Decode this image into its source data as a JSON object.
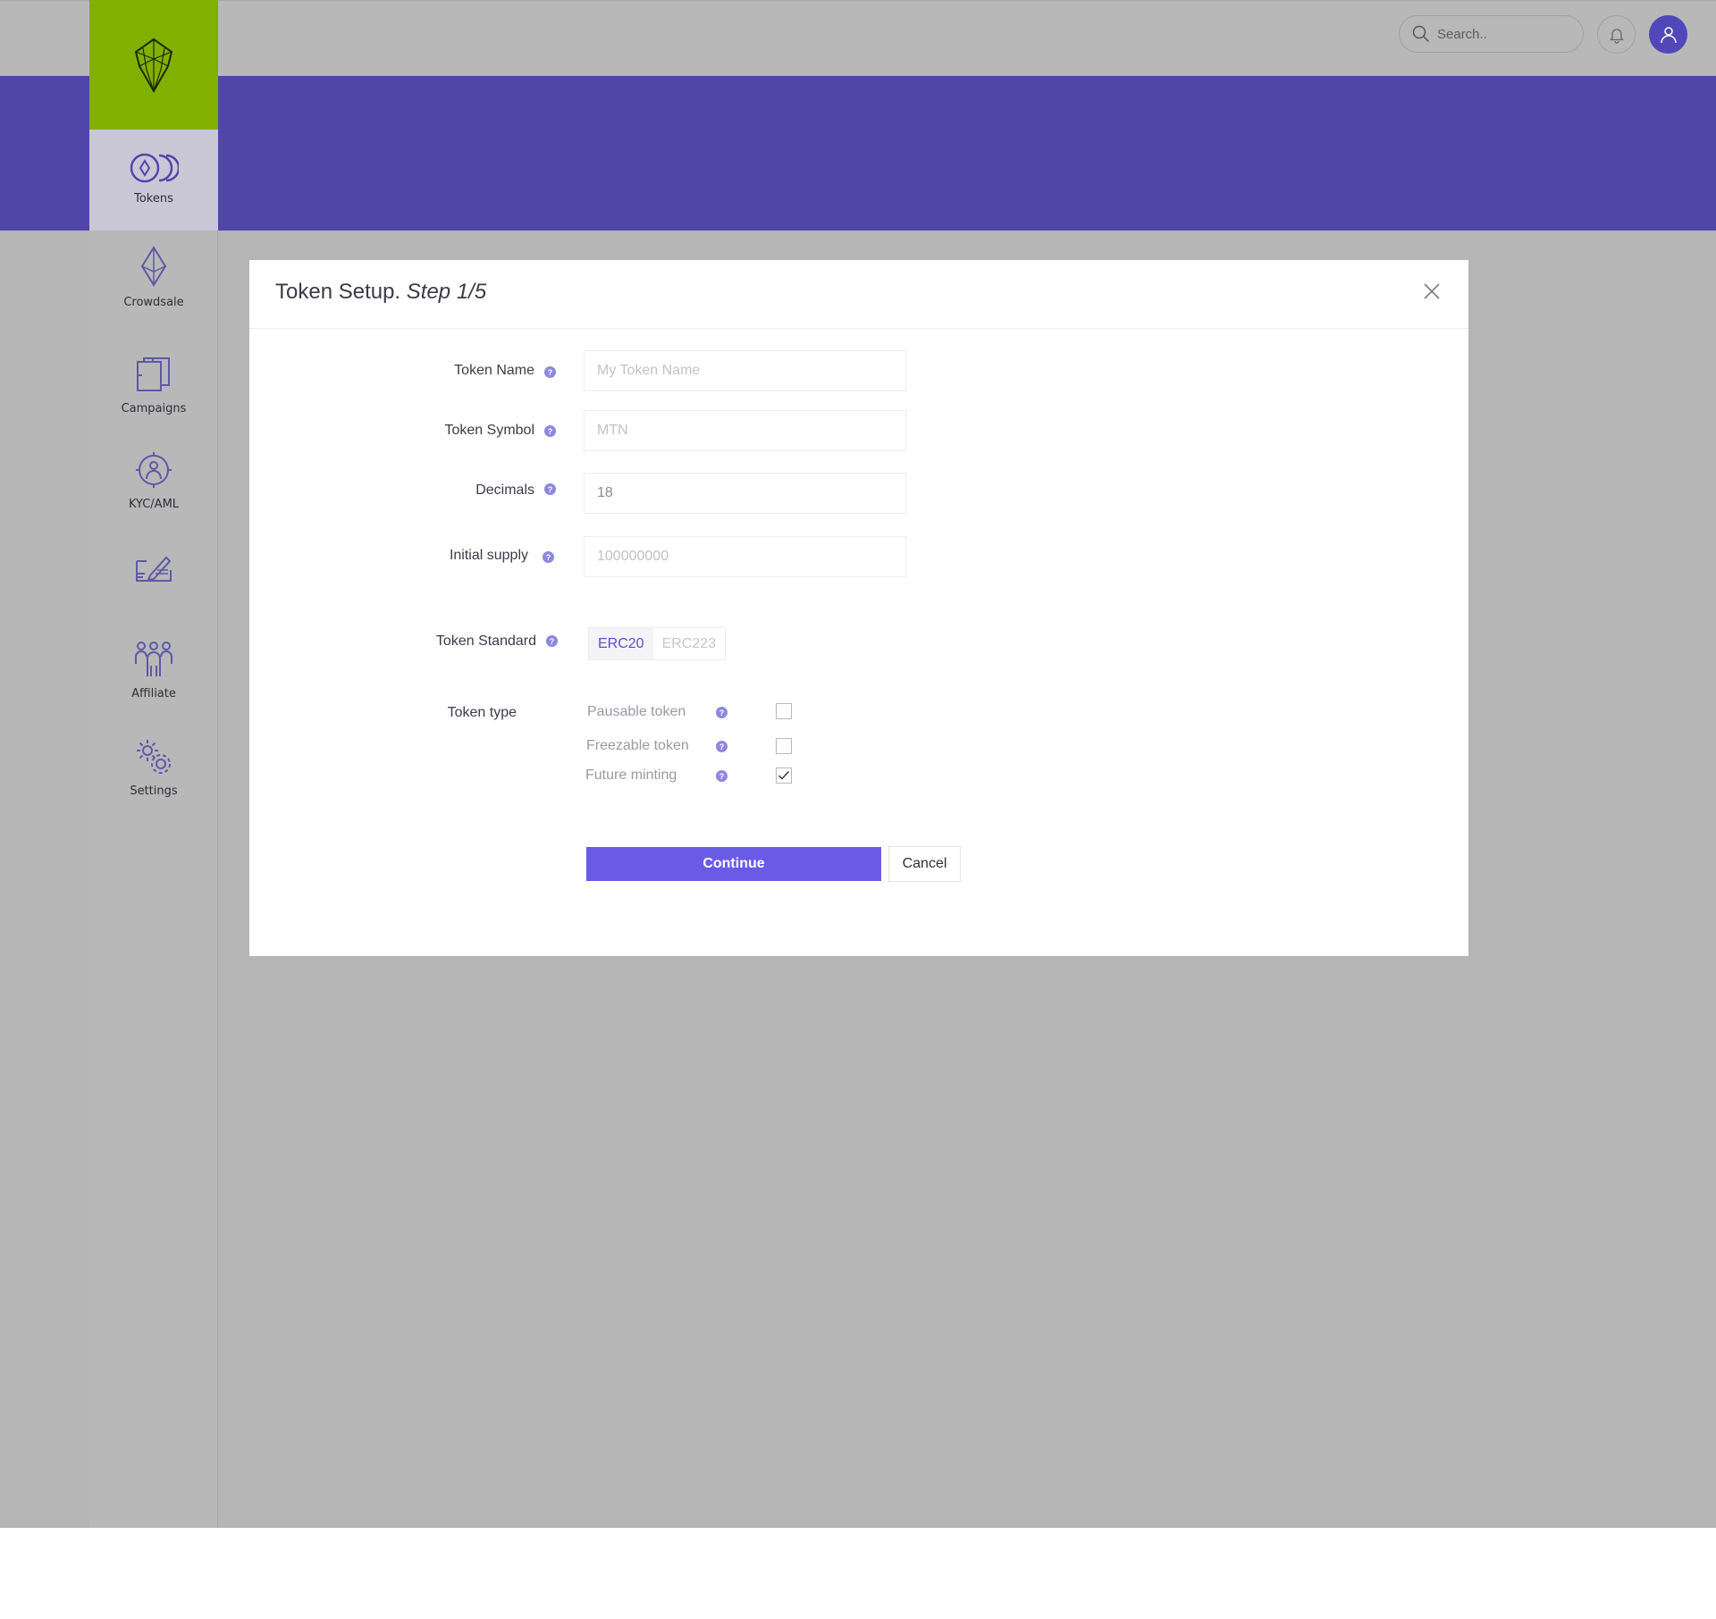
{
  "header": {
    "search_placeholder": "Search.."
  },
  "sidebar": {
    "items": [
      {
        "label": "Tokens",
        "icon": "tokens-icon",
        "active": true
      },
      {
        "label": "Crowdsale",
        "icon": "ethereum-icon"
      },
      {
        "label": "Campaigns",
        "icon": "campaigns-icon"
      },
      {
        "label": "KYC/AML",
        "icon": "kyc-target-icon"
      },
      {
        "label": "",
        "icon": "signature-icon"
      },
      {
        "label": "Affiliate",
        "icon": "affiliate-group-icon"
      },
      {
        "label": "Settings",
        "icon": "settings-gears-icon"
      }
    ]
  },
  "modal": {
    "title": "Token Setup.",
    "step": "Step 1/5",
    "fields": {
      "token_name": {
        "label": "Token Name",
        "placeholder": "My Token Name"
      },
      "token_symbol": {
        "label": "Token Symbol",
        "placeholder": "MTN"
      },
      "decimals": {
        "label": "Decimals",
        "value": "18"
      },
      "initial_supply": {
        "label": "Initial supply",
        "placeholder": "100000000"
      }
    },
    "token_standard": {
      "label": "Token Standard",
      "options": [
        "ERC20",
        "ERC223"
      ],
      "selected": "ERC20"
    },
    "token_type": {
      "label": "Token type",
      "options": [
        {
          "label": "Pausable token",
          "checked": false
        },
        {
          "label": "Freezable token",
          "checked": false
        },
        {
          "label": "Future minting",
          "checked": true
        }
      ]
    },
    "help_glyph": "?",
    "continue_label": "Continue",
    "cancel_label": "Cancel"
  },
  "colors": {
    "brand_green": "#82b000",
    "banner_purple": "#5046aa",
    "primary_button": "#6a5be6",
    "overlay_gray": "#b5b5b5"
  }
}
